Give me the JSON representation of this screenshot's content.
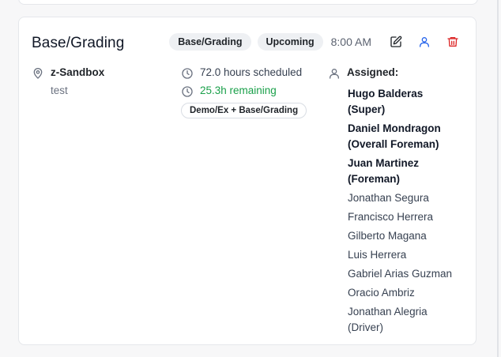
{
  "card": {
    "title": "Base/Grading",
    "badges": [
      "Base/Grading",
      "Upcoming"
    ],
    "time": "8:00 AM",
    "actions": {
      "edit_icon": "edit-icon",
      "assign_icon": "user-icon",
      "delete_icon": "trash-icon"
    },
    "colors": {
      "edit": "#1f2328",
      "assign": "#2563eb",
      "delete": "#dc2626",
      "remaining": "#1aa04a"
    }
  },
  "location": {
    "name": "z-Sandbox",
    "sub": "test"
  },
  "schedule": {
    "hours_scheduled": "72.0 hours scheduled",
    "remaining": "25.3h remaining",
    "tag": "Demo/Ex + Base/Grading"
  },
  "assigned": {
    "label": "Assigned:",
    "people": [
      {
        "name": "Hugo Balderas (Super)",
        "lead": true
      },
      {
        "name": "Daniel Mondragon (Overall Foreman)",
        "lead": true
      },
      {
        "name": "Juan Martinez (Foreman)",
        "lead": true
      },
      {
        "name": "Jonathan Segura",
        "lead": false
      },
      {
        "name": "Francisco Herrera",
        "lead": false
      },
      {
        "name": "Gilberto Magana",
        "lead": false
      },
      {
        "name": "Luis Herrera",
        "lead": false
      },
      {
        "name": "Gabriel Arias Guzman",
        "lead": false
      },
      {
        "name": "Oracio Ambriz",
        "lead": false
      },
      {
        "name": "Jonathan Alegria (Driver)",
        "lead": false
      }
    ]
  }
}
